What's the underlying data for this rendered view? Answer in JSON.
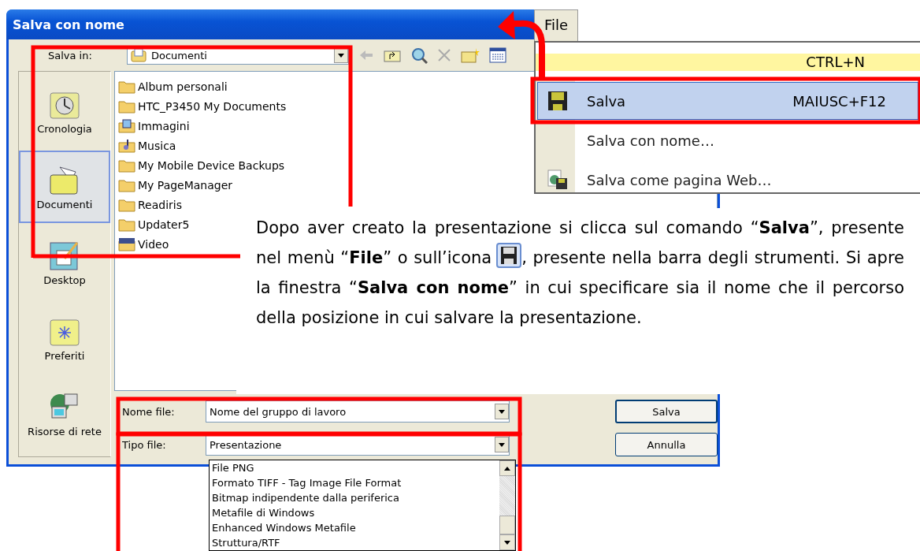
{
  "dialog": {
    "title": "Salva con nome",
    "save_in_label": "Salva in:",
    "save_in_value": "Documenti",
    "places": [
      {
        "label": "Cronologia",
        "kind": "history",
        "selected": false
      },
      {
        "label": "Documenti",
        "kind": "documents",
        "selected": true
      },
      {
        "label": "Desktop",
        "kind": "desktop",
        "selected": false
      },
      {
        "label": "Preferiti",
        "kind": "favorites",
        "selected": false
      },
      {
        "label": "Risorse di rete",
        "kind": "network",
        "selected": false
      }
    ],
    "files": [
      {
        "name": "Album personali",
        "kind": "folder"
      },
      {
        "name": "HTC_P3450 My Documents",
        "kind": "folder"
      },
      {
        "name": "Immagini",
        "kind": "pictures"
      },
      {
        "name": "Musica",
        "kind": "music"
      },
      {
        "name": "My Mobile Device Backups",
        "kind": "folder"
      },
      {
        "name": "My PageManager",
        "kind": "folder"
      },
      {
        "name": "Readiris",
        "kind": "folder"
      },
      {
        "name": "Updater5",
        "kind": "folder"
      },
      {
        "name": "Video",
        "kind": "video"
      }
    ],
    "file_name_label": "Nome file:",
    "file_name_value": "Nome del gruppo di lavoro",
    "file_type_label": "Tipo file:",
    "file_type_value": "Presentazione",
    "file_type_options": [
      "File PNG",
      "Formato TIFF - Tag Image File Format",
      "Bitmap indipendente dalla periferica",
      "Metafile di Windows",
      "Enhanced Windows Metafile",
      "Struttura/RTF"
    ],
    "buttons": [
      "Salva",
      "Annulla"
    ]
  },
  "menu": {
    "title": "File",
    "items": [
      {
        "kind": "torn",
        "shortcut": "CTRL+N"
      },
      {
        "kind": "save",
        "label": "Salva",
        "shortcut": "MAIUSC+F12",
        "selected": true
      },
      {
        "kind": "plain",
        "label": "Salva con nome…",
        "selected": false
      },
      {
        "kind": "web",
        "label": "Salva come pagina Web…",
        "selected": false
      }
    ]
  },
  "paragraph_before": "Dopo aver creato la presentazione si clicca sul comando “**Salva**”, presente nel menù “**File**” o sull’icona",
  "paragraph_after": ", presente nella barra degli strumenti. Si apre la finestra “**Salva con nome**” in cui specificare sia il nome che il percorso della posizione in cui salvare la presentazione."
}
